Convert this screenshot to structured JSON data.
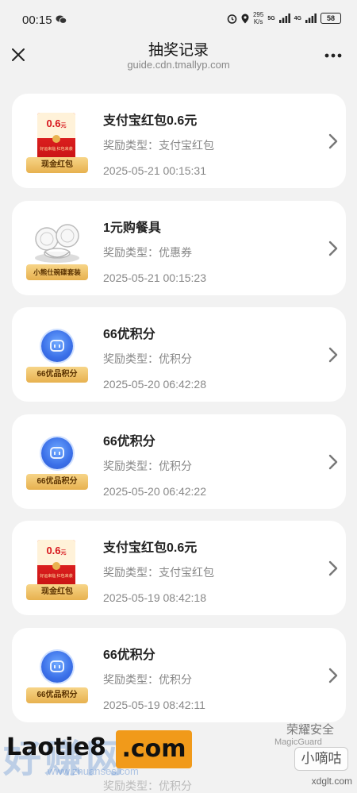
{
  "status_bar": {
    "time": "00:15",
    "speed_value": "295",
    "speed_unit": "K/s",
    "signal1": "5G",
    "signal2": "4G",
    "battery": "58"
  },
  "nav": {
    "title": "抽奖记录",
    "url": "guide.cdn.tmallyp.com"
  },
  "type_label": "奖励类型：",
  "records": [
    {
      "name": "支付宝红包0.6元",
      "type": "支付宝红包",
      "time": "2025-05-21 00:15:31",
      "thumb": "red-envelope",
      "thumb_amount": "0.6",
      "thumb_unit": "元",
      "thumb_caption": "好运来临 红包来袭",
      "ribbon": "现金红包"
    },
    {
      "name": "1元购餐具",
      "type": "优惠券",
      "time": "2025-05-21 00:15:23",
      "thumb": "dishes",
      "ribbon": "小熊仕碗碟套装"
    },
    {
      "name": "66优积分",
      "type": "优积分",
      "time": "2025-05-20 06:42:28",
      "thumb": "points-coin",
      "ribbon": "66优品积分"
    },
    {
      "name": "66优积分",
      "type": "优积分",
      "time": "2025-05-20 06:42:22",
      "thumb": "points-coin",
      "ribbon": "66优品积分"
    },
    {
      "name": "支付宝红包0.6元",
      "type": "支付宝红包",
      "time": "2025-05-19 08:42:18",
      "thumb": "red-envelope",
      "thumb_amount": "0.6",
      "thumb_unit": "元",
      "thumb_caption": "好运来临 红包来袭",
      "ribbon": "现金红包"
    },
    {
      "name": "66优积分",
      "type": "优积分",
      "time": "2025-05-19 08:42:11",
      "thumb": "points-coin",
      "ribbon": "66优品积分"
    }
  ],
  "partial_next_type": "奖励类型：优积分",
  "watermarks": {
    "site_ghost": "好赚网",
    "site_ghost_url": "www.zhuanses.com",
    "laotie": "Laotie8",
    "com": ".com",
    "honor": "荣耀安全",
    "magicguard": "MagicGuard",
    "xdd": "小嘀咕",
    "xdglt": "xdglt.com"
  }
}
